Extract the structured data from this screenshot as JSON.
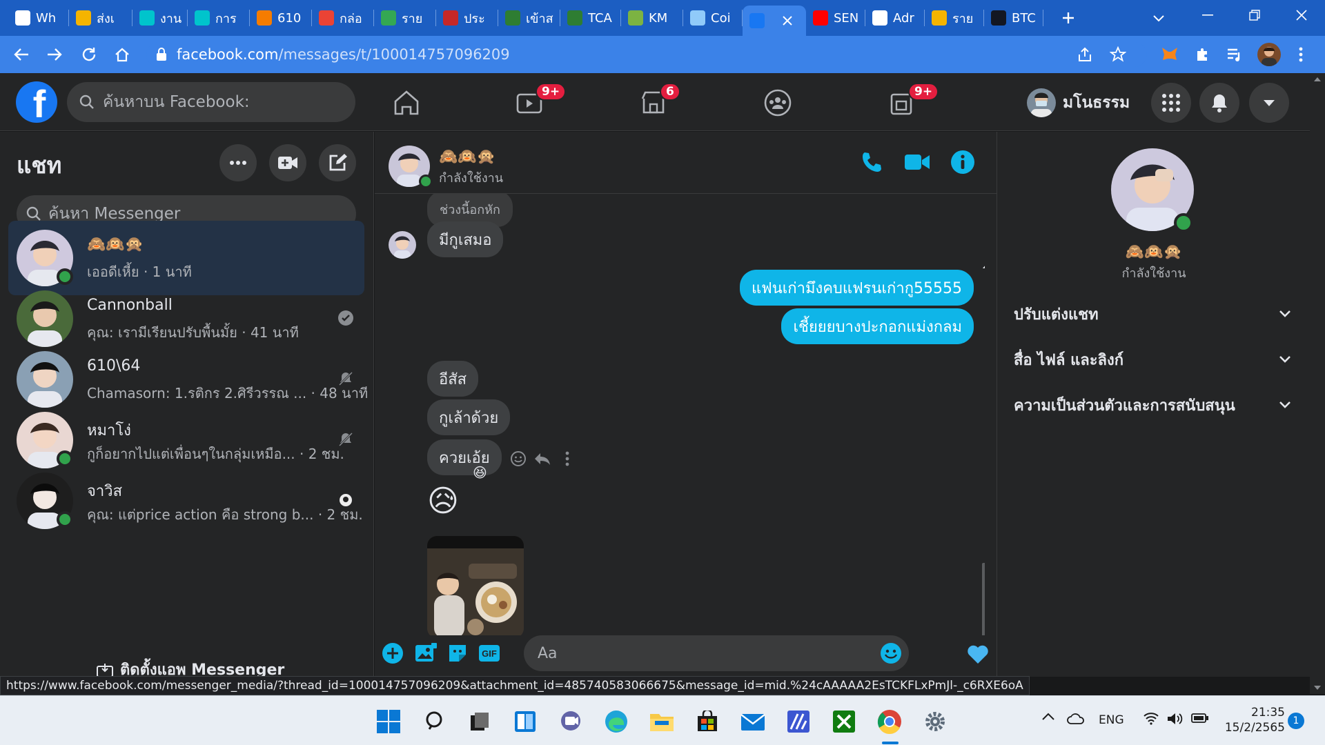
{
  "browser": {
    "tabs": [
      {
        "label": "Wh",
        "favicon": "chatgpt-icon",
        "color": "#ffffff"
      },
      {
        "label": "ส่งเ",
        "favicon": "classroom-icon",
        "color": "#f5b400"
      },
      {
        "label": "งาน",
        "favicon": "canva-icon",
        "color": "#00c4cc"
      },
      {
        "label": "การ",
        "favicon": "canva-icon",
        "color": "#00c4cc"
      },
      {
        "label": "610",
        "favicon": "classroom-icon",
        "color": "#f57c00"
      },
      {
        "label": "กล่อ",
        "favicon": "gmail-icon",
        "color": "#ea4335"
      },
      {
        "label": "ราย",
        "favicon": "drive-icon",
        "color": "#34a853"
      },
      {
        "label": "ประ",
        "favicon": "school-icon",
        "color": "#c62828"
      },
      {
        "label": "เข้าส",
        "favicon": "tca-icon",
        "color": "#2e7d32"
      },
      {
        "label": "TCA",
        "favicon": "tca-icon",
        "color": "#2e7d32"
      },
      {
        "label": "KM",
        "favicon": "book-icon",
        "color": "#7cb342"
      },
      {
        "label": "Coi",
        "favicon": "coin-icon",
        "color": "#90caf9"
      },
      {
        "label": "",
        "favicon": "facebook-icon",
        "color": "#1877f2",
        "active": true
      },
      {
        "label": "SEN",
        "favicon": "youtube-icon",
        "color": "#ff0000"
      },
      {
        "label": "Adr",
        "favicon": "globe-icon",
        "color": "#ffffff"
      },
      {
        "label": "ราย",
        "favicon": "classroom-icon",
        "color": "#f5b400"
      },
      {
        "label": "BTC",
        "favicon": "tradingview-icon",
        "color": "#131722"
      }
    ],
    "url_host": "facebook.com",
    "url_path": "/messages/t/100014757096209",
    "status_url": "https://www.facebook.com/messenger_media/?thread_id=100014757096209&attachment_id=485740583066675&message_id=mid.%24cAAAAA2EsTCKFLxPmJl-_c6RXE6oA"
  },
  "fb": {
    "search_placeholder": "ค้นหาบน Facebook:",
    "badges": {
      "watch": "9+",
      "marketplace": "6",
      "gaming": "9+"
    },
    "profile_name": "มโนธรรม"
  },
  "chats": {
    "title": "แชท",
    "search_placeholder": "ค้นหา Messenger",
    "install_label": "ติดตั้งแอพ Messenger",
    "list": [
      {
        "name": "🙈🙉🙊",
        "preview": "เออดีเหี้ย · 1 นาที",
        "online": true,
        "active": true,
        "status_icon": ""
      },
      {
        "name": "Cannonball",
        "preview": "คุณ: เรามีเรียนปรับพื้นมั้ย · 41 นาที",
        "online": false,
        "active": false,
        "status_icon": "seen-check-icon"
      },
      {
        "name": "610\\64",
        "preview": "Chamasorn: 1.รติกร 2.ศิรีวรรณ ... · 48 นาที",
        "online": false,
        "active": false,
        "status_icon": "muted-bell-icon"
      },
      {
        "name": "หมาโง่",
        "preview": "กูก็อยากไปแต่เพื่อนๆในกลุ่มเหมือ... · 2 ชม.",
        "online": true,
        "active": false,
        "status_icon": "muted-bell-icon"
      },
      {
        "name": "จาวิส",
        "preview": "คุณ: แต่price action คือ strong b... · 2 ชม.",
        "online": true,
        "active": false,
        "status_icon": "seen-avatar-icon"
      }
    ]
  },
  "thread": {
    "name": "🙈🙉🙊",
    "status": "กำลังใช้งาน",
    "messages": {
      "reply_quote": "ช่วงนี้อกหัก",
      "m1": "มีกูเสมอ",
      "m2": "แฟนเก่ามึงคบแฟรนเก่ากู55555",
      "m3": "เชี้ยยยบางปะกอกแม่งกลม",
      "m4": "อีสัส",
      "m5": "กูเล้าด้วย",
      "m6": "ควยเอ้ย",
      "reaction": "😆",
      "emoji_msg": "😥"
    },
    "composer_placeholder": "Aa"
  },
  "info_panel": {
    "name": "🙈🙉🙊",
    "status": "กำลังใช้งาน",
    "sections": [
      "ปรับแต่งแชท",
      "สื่อ ไฟล์ และลิงก์",
      "ความเป็นส่วนตัวและการสนับสนุน"
    ]
  },
  "taskbar": {
    "lang": "ENG",
    "time": "21:35",
    "date": "15/2/2565",
    "notifications": "1"
  },
  "colors": {
    "accent": "#0fb5e8",
    "fb_blue": "#1877f2",
    "chrome_blue": "#3b82e8"
  }
}
